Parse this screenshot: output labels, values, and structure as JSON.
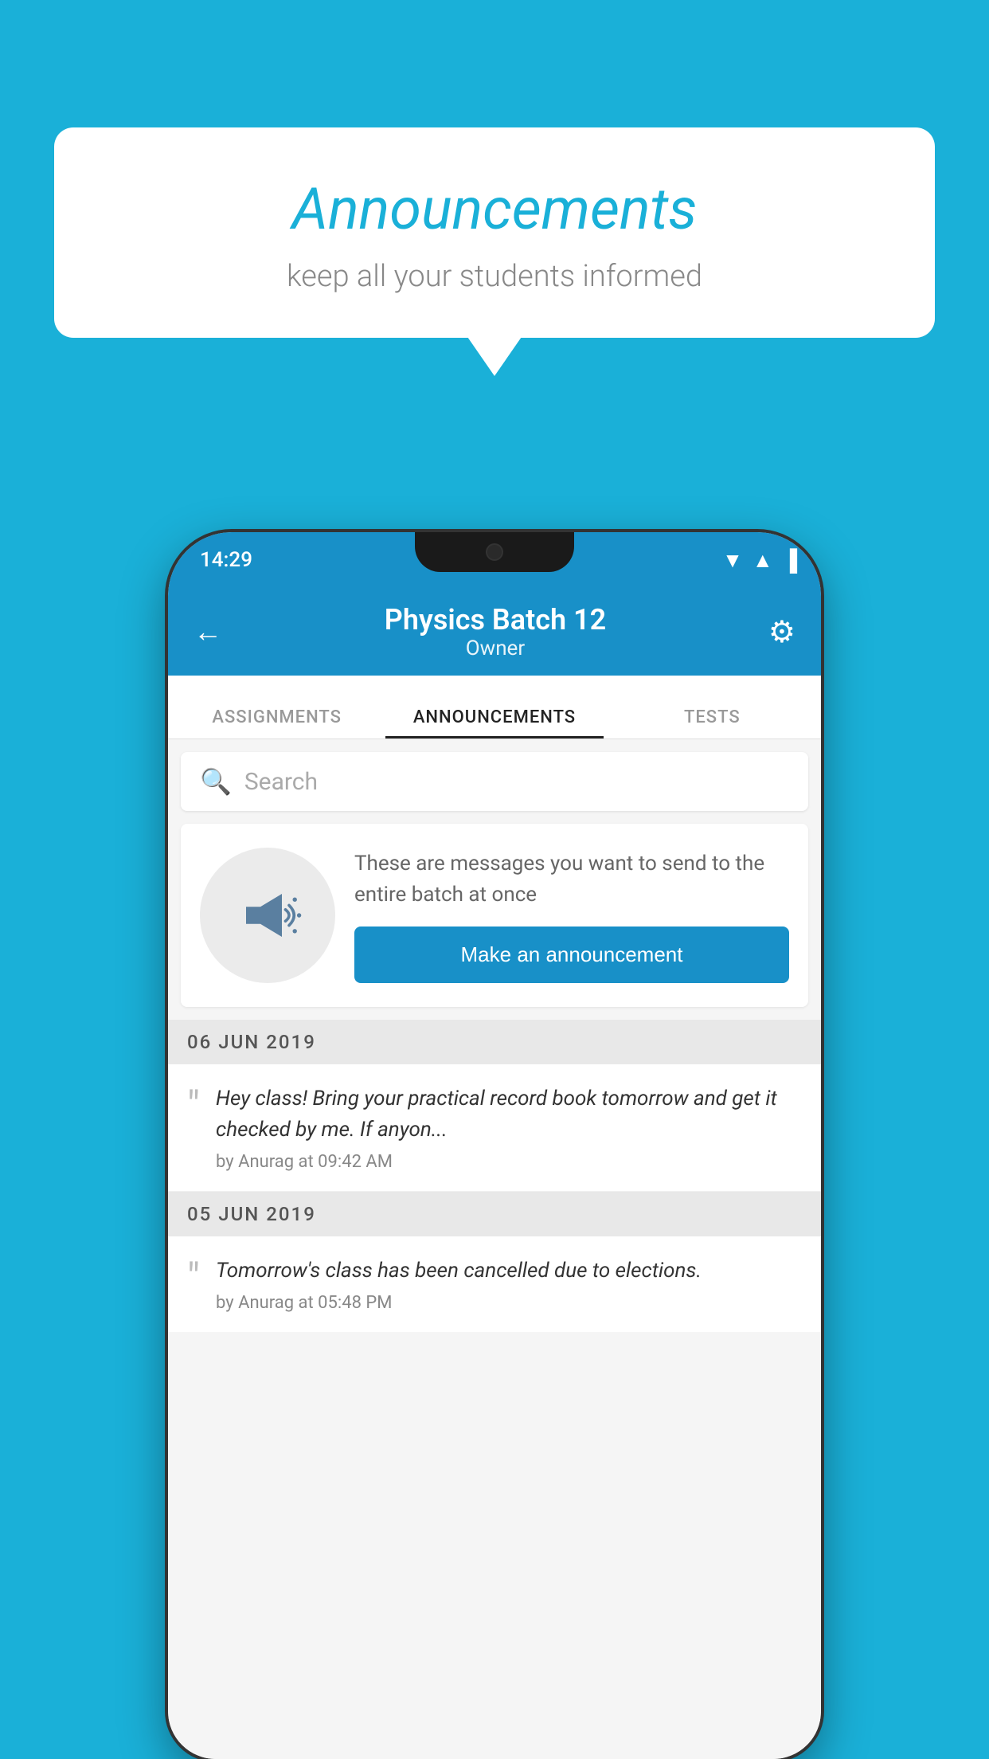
{
  "background": {
    "color": "#1ab0d8"
  },
  "speech_bubble": {
    "title": "Announcements",
    "subtitle": "keep all your students informed"
  },
  "phone": {
    "status_bar": {
      "time": "14:29"
    },
    "header": {
      "title": "Physics Batch 12",
      "subtitle": "Owner",
      "back_label": "←",
      "settings_label": "⚙"
    },
    "tabs": [
      {
        "label": "ASSIGNMENTS",
        "active": false
      },
      {
        "label": "ANNOUNCEMENTS",
        "active": true
      },
      {
        "label": "TESTS",
        "active": false
      }
    ],
    "search": {
      "placeholder": "Search"
    },
    "announcement_prompt": {
      "description": "These are messages you want to send to the entire batch at once",
      "button_label": "Make an announcement"
    },
    "date_groups": [
      {
        "date": "06  JUN  2019",
        "items": [
          {
            "text": "Hey class! Bring your practical record book tomorrow and get it checked by me. If anyon...",
            "meta": "by Anurag at 09:42 AM"
          }
        ]
      },
      {
        "date": "05  JUN  2019",
        "items": [
          {
            "text": "Tomorrow's class has been cancelled due to elections.",
            "meta": "by Anurag at 05:48 PM"
          }
        ]
      }
    ]
  }
}
